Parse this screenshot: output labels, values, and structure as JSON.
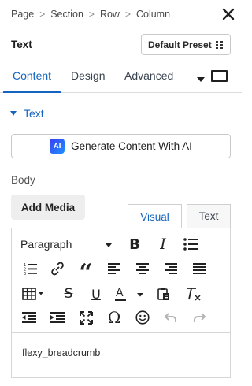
{
  "breadcrumb": [
    "Page",
    "Section",
    "Row",
    "Column"
  ],
  "panel": {
    "title": "Text",
    "preset_label": "Default Preset"
  },
  "tabs": [
    {
      "label": "Content",
      "active": true
    },
    {
      "label": "Design",
      "active": false
    },
    {
      "label": "Advanced",
      "active": false
    }
  ],
  "section": {
    "label": "Text",
    "expanded": true
  },
  "ai": {
    "badge": "AI",
    "button_label": "Generate Content With AI"
  },
  "body": {
    "label": "Body",
    "add_media_label": "Add Media"
  },
  "editor": {
    "mode_tabs": {
      "visual": "Visual",
      "text": "Text",
      "active": "Visual"
    },
    "format_select": "Paragraph",
    "content": "flexy_breadcrumb"
  },
  "colors": {
    "accent": "#1565c0",
    "border": "#d6d6d6",
    "text": "#222222"
  }
}
